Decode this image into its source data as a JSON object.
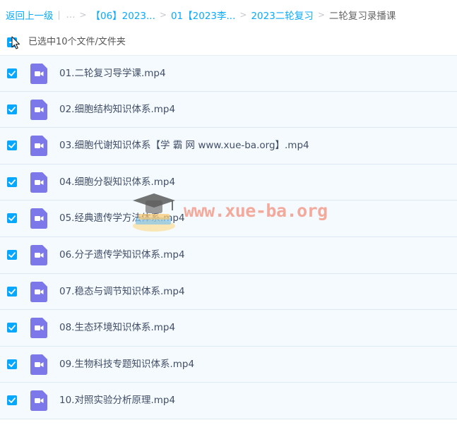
{
  "breadcrumb": {
    "back": "返回上一级",
    "ellipsis": "...",
    "items": [
      "【06】2023...",
      "01【2023李...",
      "2023二轮复习"
    ],
    "current": "二轮复习录播课"
  },
  "selection": {
    "label": "已选中10个文件/文件夹"
  },
  "files": [
    {
      "name": "01.二轮复习导学课.mp4",
      "checked": true
    },
    {
      "name": "02.细胞结构知识体系.mp4",
      "checked": true
    },
    {
      "name": "03.细胞代谢知识体系【学 霸 网 www.xue-ba.org】.mp4",
      "checked": true
    },
    {
      "name": "04.细胞分裂知识体系.mp4",
      "checked": true
    },
    {
      "name": "05.经典遗传学方法体系.mp4",
      "checked": true
    },
    {
      "name": "06.分子遗传学知识体系.mp4",
      "checked": true
    },
    {
      "name": "07.稳态与调节知识体系.mp4",
      "checked": true
    },
    {
      "name": "08.生态环境知识体系.mp4",
      "checked": true
    },
    {
      "name": "09.生物科技专题知识体系.mp4",
      "checked": true
    },
    {
      "name": "10.对照实验分析原理.mp4",
      "checked": true
    }
  ],
  "watermark": {
    "text": "www.xue-ba.org"
  },
  "colors": {
    "accent": "#06a7ff",
    "link": "#09aaff",
    "video_icon": "#7c78ea",
    "row_bg": "#f4faff"
  },
  "icons": {
    "file": "video-file-icon",
    "checkbox": "checkbox-checked-icon",
    "cursor": "mouse-pointer-icon"
  }
}
